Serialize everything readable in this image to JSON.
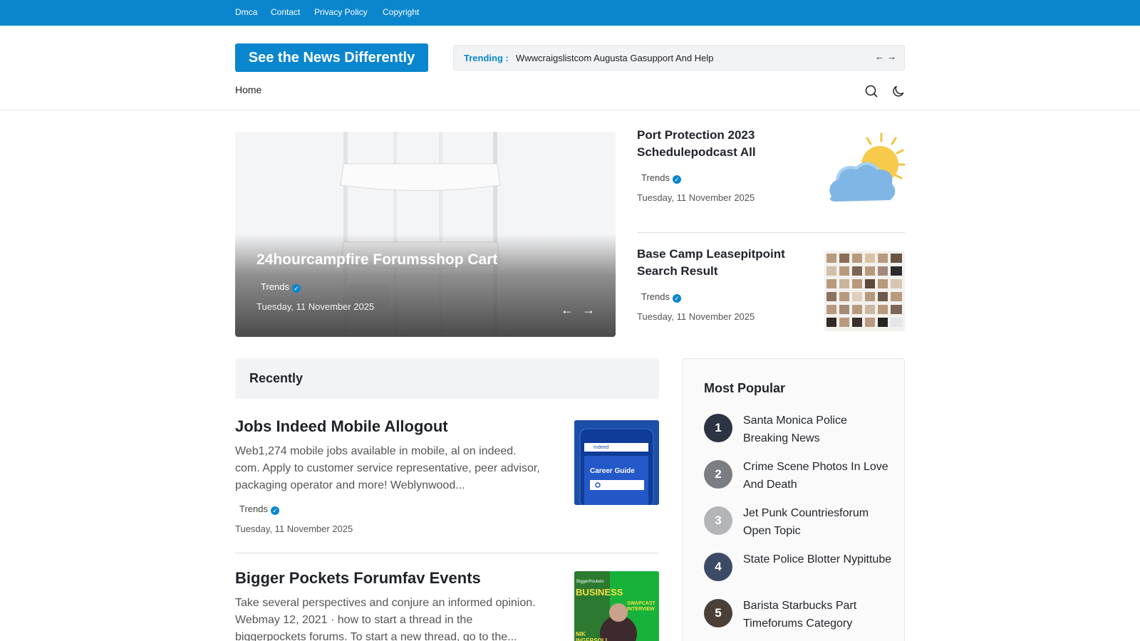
{
  "topbar": {
    "links": [
      "Dmca",
      "Contact",
      "Privacy Policy",
      "Copyright"
    ]
  },
  "header": {
    "brand": "See the News Differently",
    "trending_label": "Trending :",
    "trending_text": "Wwwcraigslistcom Augusta Gasupport And Help",
    "prev_arrow": "←",
    "next_arrow": "→"
  },
  "nav": {
    "home": "Home",
    "icons": [
      "search-icon",
      "moon-icon"
    ]
  },
  "hero": {
    "title": "24hourcampfire Forumsshop Cart",
    "category": "Trends",
    "date": "Tuesday, 11 November 2025",
    "prev": "←",
    "next": "→"
  },
  "side_posts": [
    {
      "title": "Port Protection 2023 Schedulepodcast All",
      "category": "Trends",
      "date": "Tuesday, 11 November 2025"
    },
    {
      "title": "Base Camp Leasepitpoint Search Result",
      "category": "Trends",
      "date": "Tuesday, 11 November 2025"
    }
  ],
  "recent": {
    "heading": "Recently",
    "posts": [
      {
        "title": "Jobs Indeed Mobile Allogout",
        "description": "Web1,274 mobile jobs available in mobile, al on indeed. com. Apply to customer service representative, peer advisor, packaging operator and more! Weblynwood...",
        "category": "Trends",
        "date": "Tuesday, 11 November 2025",
        "thumb_text": [
          "Indeed",
          "Career Guide"
        ]
      },
      {
        "title": "Bigger Pockets Forumfav Events",
        "description": "Take several perspectives and conjure an informed opinion. Webmay 12, 2021 · how to start a thread in the biggerpockets forums. To start a new thread, go to the...",
        "category": "Trends",
        "date": "Tuesday, 11 November 2025",
        "thumb_text": [
          "BiggerPockets",
          "BUSINESS",
          "SWAPCAST INTERVIEW",
          "NIK INGERSOLL"
        ]
      }
    ]
  },
  "popular": {
    "heading": "Most Popular",
    "items": [
      {
        "rank": "1",
        "title": "Santa Monica Police Breaking News"
      },
      {
        "rank": "2",
        "title": "Crime Scene Photos In Love And Death"
      },
      {
        "rank": "3",
        "title": "Jet Punk Countriesforum Open Topic"
      },
      {
        "rank": "4",
        "title": "State Police Blotter Nypittube"
      },
      {
        "rank": "5",
        "title": "Barista Starbucks Part Timeforums Category"
      }
    ]
  },
  "colors": {
    "accent": "#0a86ce",
    "text": "#1f2329",
    "muted": "#555555",
    "panel": "#f2f3f5"
  }
}
